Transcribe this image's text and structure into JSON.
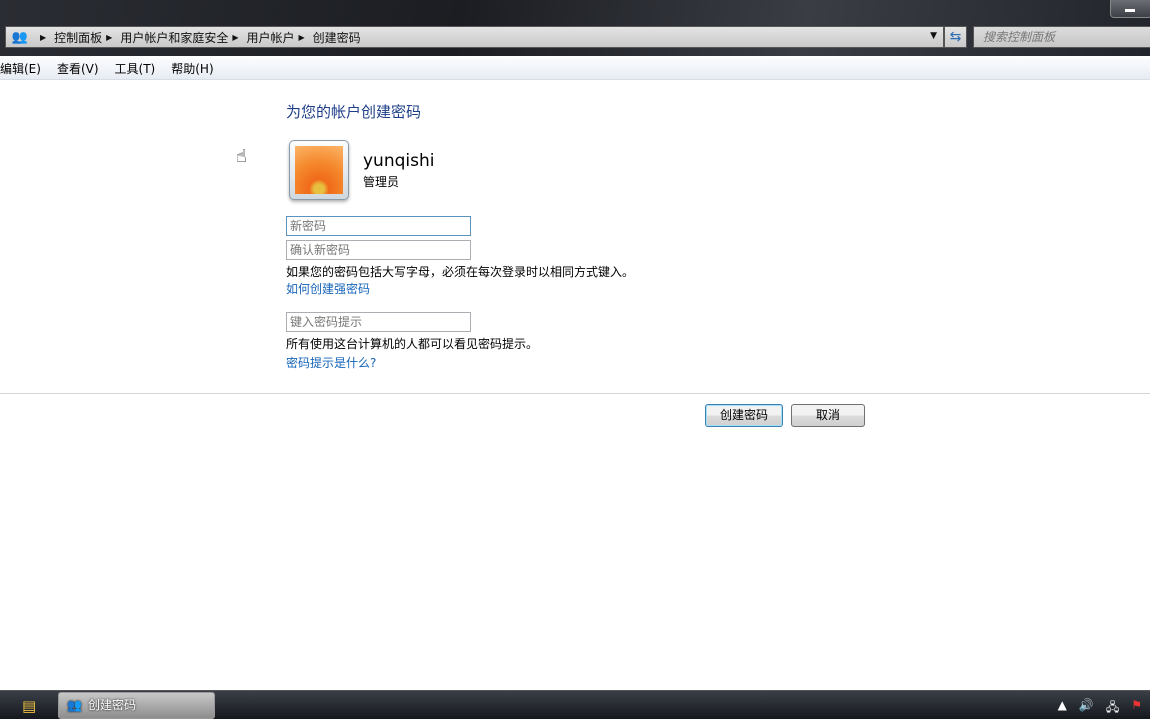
{
  "window": {
    "breadcrumb": [
      "控制面板",
      "用户帐户和家庭安全",
      "用户帐户",
      "创建密码"
    ],
    "search_placeholder": "搜索控制面板"
  },
  "menu": [
    "编辑(E)",
    "查看(V)",
    "工具(T)",
    "帮助(H)"
  ],
  "main": {
    "title": "为您的帐户创建密码",
    "user": {
      "name": "yunqishi",
      "role": "管理员"
    },
    "new_password_placeholder": "新密码",
    "confirm_password_placeholder": "确认新密码",
    "case_note": "如果您的密码包括大写字母，必须在每次登录时以相同方式键入。",
    "strong_password_link": "如何创建强密码",
    "hint_placeholder": "键入密码提示",
    "hint_note": "所有使用这台计算机的人都可以看见密码提示。",
    "hint_link": "密码提示是什么?",
    "create_button": "创建密码",
    "cancel_button": "取消"
  },
  "taskbar": {
    "task_label": "创建密码"
  },
  "colors": {
    "title": "#1e3f87",
    "link": "#1664b8"
  }
}
